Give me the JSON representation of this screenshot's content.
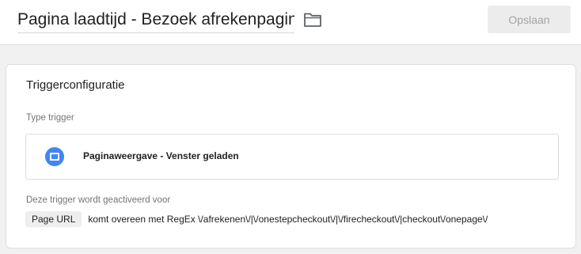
{
  "header": {
    "title": "Pagina laadtijd - Bezoek afrekenpagina",
    "folder_icon": "folder-icon",
    "save_label": "Opslaan"
  },
  "trigger_config": {
    "title": "Triggerconfiguratie",
    "type_label": "Type trigger",
    "type_name": "Paginaweergave - Venster geladen",
    "type_icon": "page-window-icon",
    "type_icon_color": "#4285f4",
    "activation_label": "Deze trigger wordt geactiveerd voor",
    "condition": {
      "variable": "Page URL",
      "text": "komt overeen met RegEx \\/afrekenen\\/|\\/onestepcheckout\\/|\\/firecheckout\\/|checkout\\/onepage\\/"
    }
  }
}
